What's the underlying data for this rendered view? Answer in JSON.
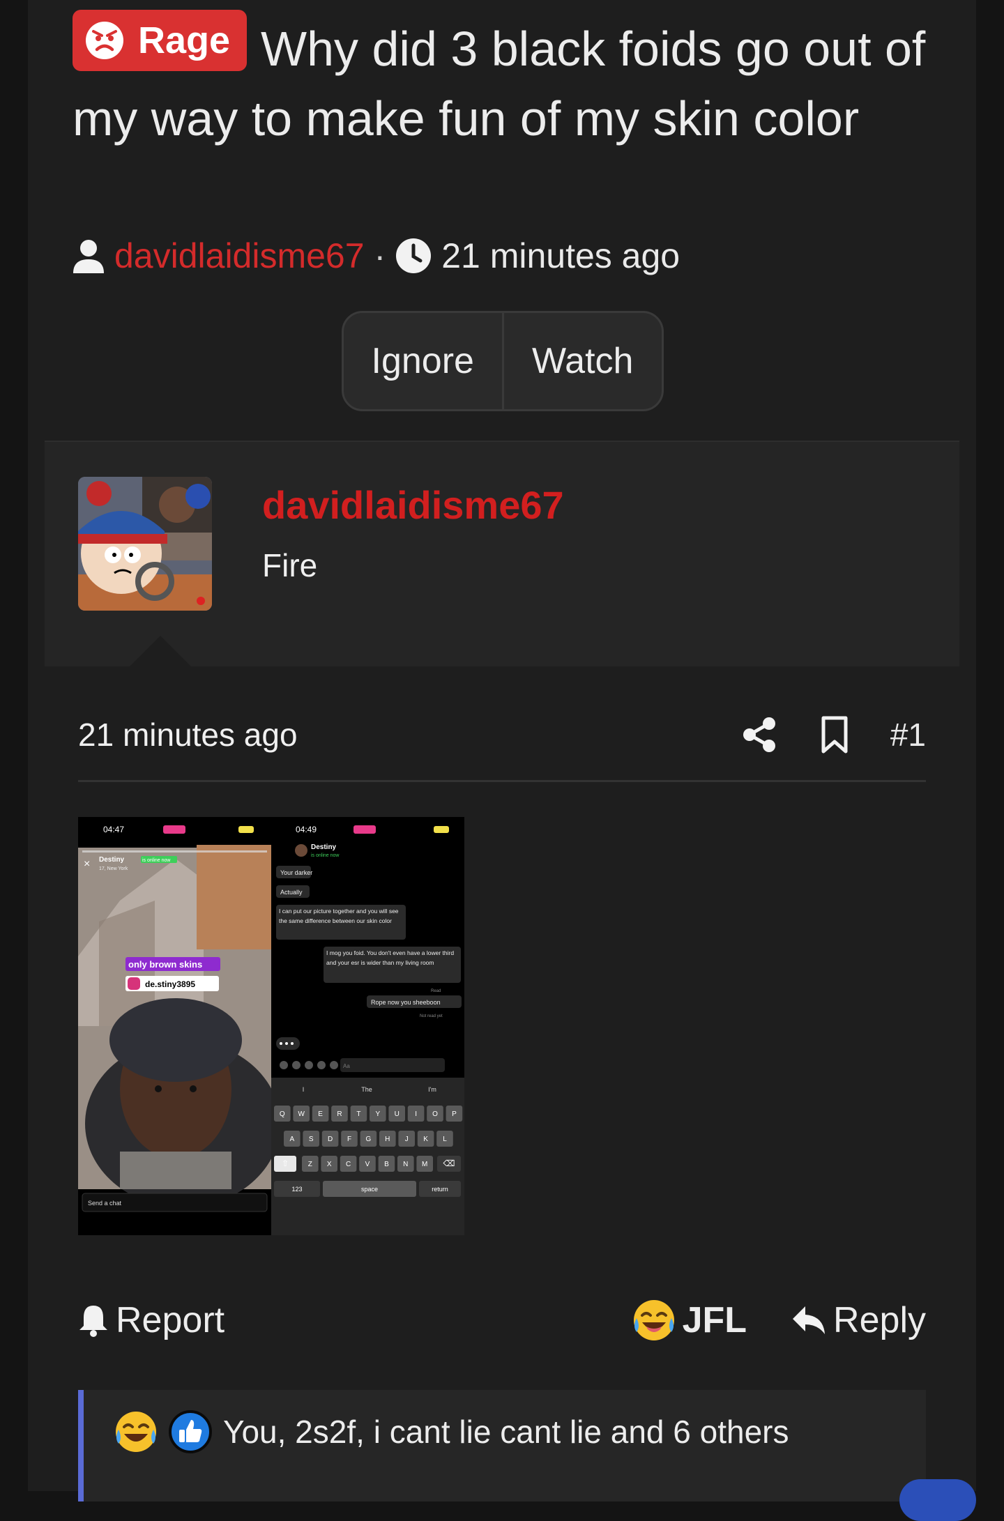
{
  "thread": {
    "prefix_label": "Rage",
    "title": "Why did 3 black foids go out of my way to make fun of my skin color",
    "author": "davidlaidisme67",
    "separator": "·",
    "time": "21 minutes ago",
    "buttons": {
      "ignore": "Ignore",
      "watch": "Watch"
    }
  },
  "post": {
    "username": "davidlaidisme67",
    "user_title": "Fire",
    "date": "21 minutes ago",
    "number": "#1",
    "attachment": {
      "left": {
        "clock": "04:47",
        "name": "Destiny",
        "status": "is online now",
        "sub": "17, New York",
        "sticker1": "only brown skins",
        "sticker2": "de.stiny3895",
        "chat_placeholder": "Send a chat"
      },
      "right": {
        "clock": "04:49",
        "name": "Destiny",
        "status": "is online now",
        "messages": [
          "Your darker",
          "Actually",
          "I can put our picture together and you will see the same difference between our skin color",
          "I mog you foid. You don't even have a lower third and your esr is wider than my living room",
          "Rope now you sheeboon"
        ],
        "receipt1": "Read",
        "receipt2": "Not read yet",
        "input_placeholder": "Aa",
        "suggestions": [
          "I",
          "The",
          "I'm"
        ],
        "keys_row1": [
          "Q",
          "W",
          "E",
          "R",
          "T",
          "Y",
          "U",
          "I",
          "O",
          "P"
        ],
        "keys_row2": [
          "A",
          "S",
          "D",
          "F",
          "G",
          "H",
          "J",
          "K",
          "L"
        ],
        "keys_row3": [
          "Z",
          "X",
          "C",
          "V",
          "B",
          "N",
          "M"
        ],
        "key_123": "123",
        "key_space": "space",
        "key_return": "return"
      }
    },
    "actions": {
      "report": "Report",
      "jfl": "JFL",
      "reply": "Reply"
    },
    "reactions_text": "You, 2s2f, i cant lie cant lie and 6 others"
  },
  "colors": {
    "background": "#1e1e1e",
    "rage_prefix": "#d93131",
    "username_red": "#d21f1f",
    "reaction_accent": "#5a6bd6"
  },
  "icons": {
    "prefix": "angry-face-icon",
    "author": "user-icon",
    "time": "clock-icon",
    "share": "share-icon",
    "bookmark": "bookmark-icon",
    "report": "bell-icon",
    "jfl": "laughing-crying-emoji-icon",
    "reply": "reply-icon",
    "like": "thumbs-up-icon"
  }
}
